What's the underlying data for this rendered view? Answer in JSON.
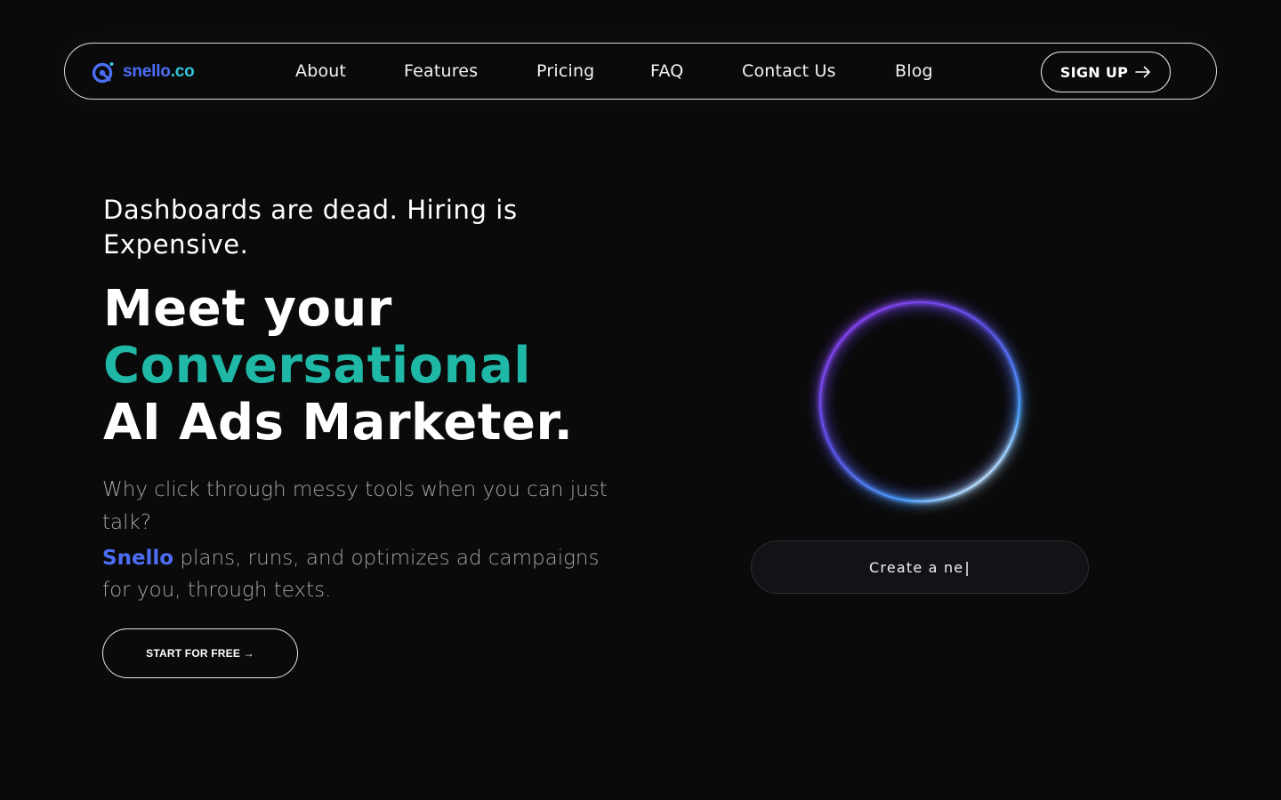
{
  "nav": {
    "brand_name": "snello",
    "brand_tld": ".co",
    "links": [
      "About",
      "Features",
      "Pricing",
      "FAQ",
      "Contact Us",
      "Blog"
    ],
    "signup_label": "SIGN UP",
    "signup_icon": "arrow-right-icon",
    "logo_icon": "snello-logo-icon"
  },
  "hero": {
    "eyebrow": "Dashboards are dead. Hiring is Expensive.",
    "headline_line1": "Meet your",
    "headline_accent": "Conversational",
    "headline_line3": "AI Ads Marketer.",
    "sub": "Why click through messy tools when you can just talk?",
    "sub2_brand": "Snello",
    "sub2_rest": " plans, runs, and optimizes ad campaigns for you, through texts.",
    "cta_label": "START FOR FREE →"
  },
  "assistant": {
    "input_value": "Create a ne",
    "caret": "|"
  },
  "colors": {
    "background": "#0a0a0b",
    "brand_blue": "#4c6ef5",
    "brand_teal": "#34c6d9",
    "accent_teal": "#1fb8a6",
    "muted_text": "#a4a4a8",
    "orb_purple": "#7b3fe4",
    "orb_blue": "#6fb7ff"
  }
}
